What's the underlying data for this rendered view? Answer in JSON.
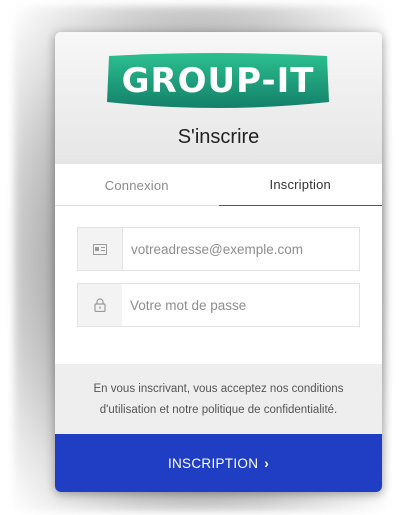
{
  "brand": {
    "logo_text": "GROUP-IT",
    "logo_color": "#1fa07a"
  },
  "header": {
    "title": "S'inscrire"
  },
  "tabs": [
    {
      "label": "Connexion",
      "active": false
    },
    {
      "label": "Inscription",
      "active": true
    }
  ],
  "form": {
    "email": {
      "placeholder": "votreadresse@exemple.com",
      "icon": "email-card-icon"
    },
    "password": {
      "placeholder": "Votre mot de passe",
      "icon": "lock-icon"
    }
  },
  "terms": {
    "line1": "En vous inscrivant, vous acceptez nos conditions",
    "line2": "d'utilisation et notre politique de confidentialité."
  },
  "submit": {
    "label": "INSCRIPTION",
    "chevron": "›",
    "color": "#1f3ec4"
  }
}
